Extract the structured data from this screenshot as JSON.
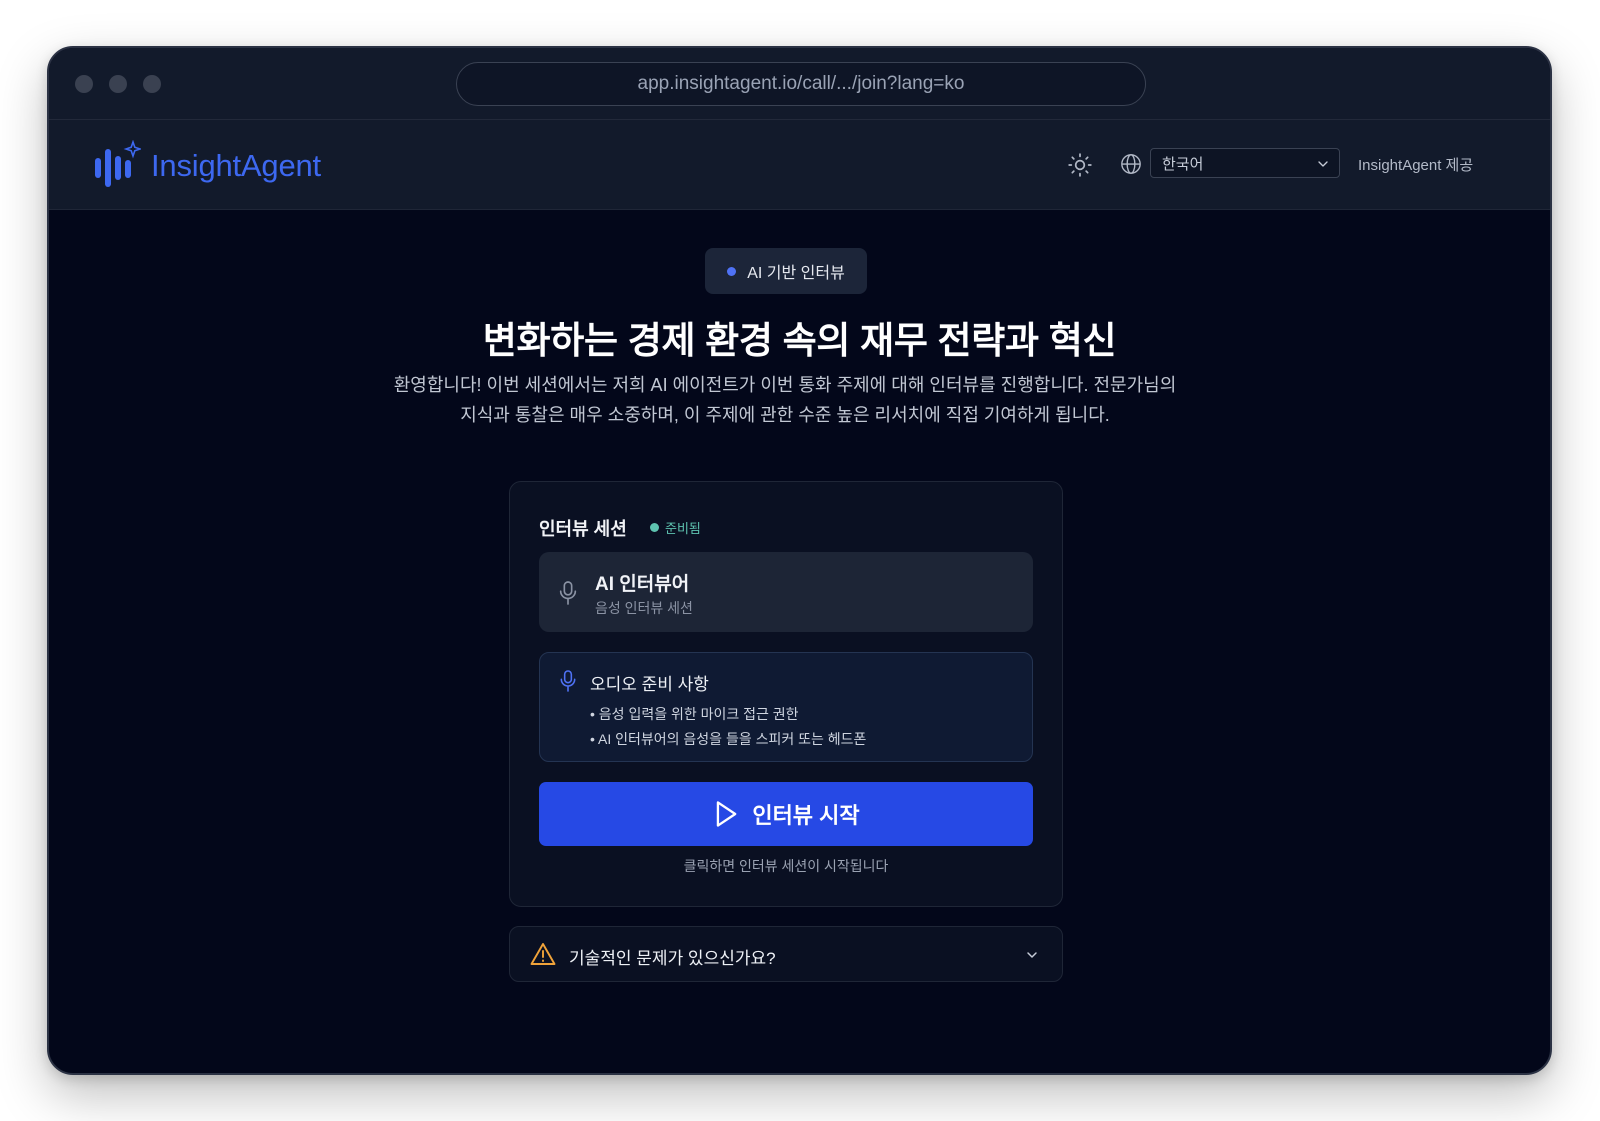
{
  "browser": {
    "url": "app.insightagent.io/call/.../join?lang=ko"
  },
  "header": {
    "brand": "InsightAgent",
    "theme_icon": "sun-icon",
    "language_icon": "globe-icon",
    "language_selected": "한국어",
    "powered_by": "InsightAgent 제공"
  },
  "hero": {
    "badge": "AI 기반 인터뷰",
    "title": "변화하는 경제 환경 속의 재무 전략과 혁신",
    "intro_line1": "환영합니다! 이번 세션에서는 저희 AI 에이전트가 이번 통화 주제에 대해 인터뷰를 진행합니다. 전문가님의",
    "intro_line2": "지식과 통찰은 매우 소중하며, 이 주제에 관한 수준 높은 리서치에 직접 기여하게 됩니다."
  },
  "session": {
    "title": "인터뷰 세션",
    "status": "준비됨",
    "interviewer_name": "AI 인터뷰어",
    "interviewer_sub": "음성 인터뷰 세션",
    "audio_title": "오디오 준비 사항",
    "audio_items": [
      "• 음성 입력을 위한 마이크 접근 권한",
      "• AI 인터뷰어의 음성을 들을 스피커 또는 헤드폰"
    ],
    "start_label": "인터뷰 시작",
    "start_hint": "클릭하면 인터뷰 세션이 시작됩니다"
  },
  "trouble": {
    "label": "기술적인 문제가 있으신가요?"
  },
  "colors": {
    "accent": "#2649e5",
    "brand": "#3d68f0",
    "status": "#5ec3b0",
    "warning": "#f0a33a",
    "background": "#03071a"
  }
}
